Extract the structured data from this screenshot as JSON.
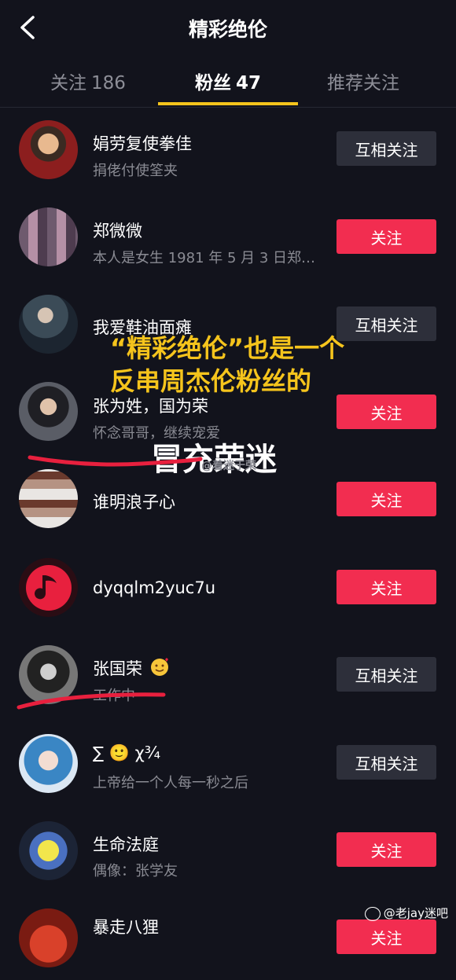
{
  "header": {
    "title": "精彩绝伦",
    "back_icon": "chevron-left-icon"
  },
  "tabs": [
    {
      "label": "关注",
      "count": "186"
    },
    {
      "label": "粉丝",
      "count": "47"
    },
    {
      "label": "推荐关注",
      "count": ""
    }
  ],
  "active_tab_index": 1,
  "accent_color": "#f5c41c",
  "follow_color": "#f22d50",
  "mutual_color": "#2d2f3a",
  "users": [
    {
      "name": "娟劳复使拳佳",
      "bio": "捐佬付使筌夹",
      "button": "互相关注",
      "type": "mutual"
    },
    {
      "name": "郑微微",
      "bio": "本人是女生 1981 年 5 月 3 日郑…",
      "button": "关注",
      "type": "follow"
    },
    {
      "name": "我爱鞋油面瘫",
      "bio": "",
      "button": "互相关注",
      "type": "mutual"
    },
    {
      "name": "张为姓，国为荣",
      "bio": "怀念哥哥，继续宠爱",
      "button": "关注",
      "type": "follow"
    },
    {
      "name": "谁明浪子心",
      "bio": "",
      "button": "关注",
      "type": "follow"
    },
    {
      "name": "dyqqlm2yuc7u",
      "bio": "",
      "button": "关注",
      "type": "follow"
    },
    {
      "name": "张国荣",
      "bio": "工作中",
      "button": "互相关注",
      "type": "mutual"
    },
    {
      "name": "∑ 🙂 χ¾",
      "bio": "上帝给一个人每一秒之后",
      "button": "互相关注",
      "type": "mutual"
    },
    {
      "name": "生命法庭",
      "bio": "偶像：张学友",
      "button": "关注",
      "type": "follow"
    },
    {
      "name": "暴走八狸",
      "bio": "",
      "button": "关注",
      "type": "follow"
    }
  ],
  "annotations": {
    "line1": "“精彩绝伦”也是一个",
    "line2": "反串周杰伦粉丝的",
    "impostor": "冒充荣迷",
    "faint_mark": "@着迷于荣"
  },
  "watermark": "@老jay迷吧"
}
